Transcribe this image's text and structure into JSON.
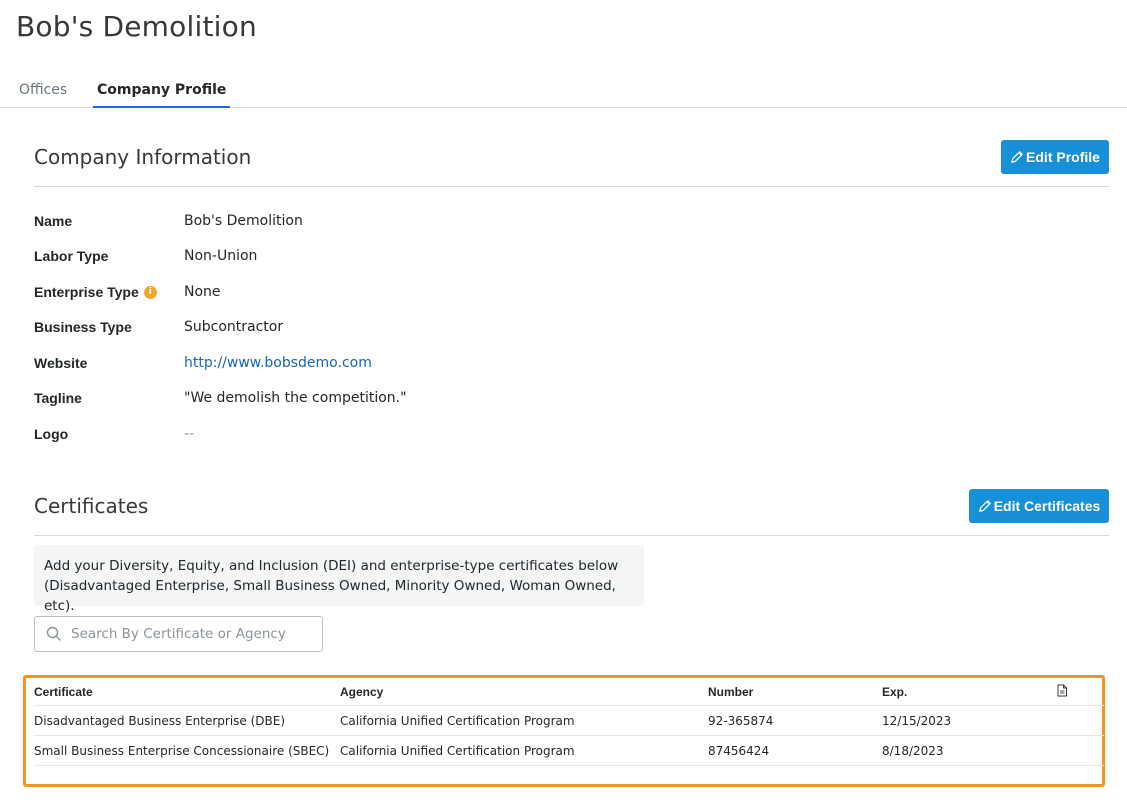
{
  "page": {
    "title": "Bob's Demolition"
  },
  "tabs": [
    {
      "label": "Offices",
      "active": false
    },
    {
      "label": "Company Profile",
      "active": true
    }
  ],
  "company_info": {
    "title": "Company Information",
    "edit_button": "Edit Profile",
    "fields": {
      "name": {
        "label": "Name",
        "value": "Bob's Demolition"
      },
      "labor_type": {
        "label": "Labor Type",
        "value": "Non-Union"
      },
      "enterprise_type": {
        "label": "Enterprise Type",
        "value": "None",
        "info_icon": "i"
      },
      "business_type": {
        "label": "Business Type",
        "value": "Subcontractor"
      },
      "website": {
        "label": "Website",
        "value": "http://www.bobsdemo.com"
      },
      "tagline": {
        "label": "Tagline",
        "value": "\"We demolish the competition.\""
      },
      "logo": {
        "label": "Logo",
        "value": "--"
      }
    }
  },
  "certificates": {
    "title": "Certificates",
    "edit_button": "Edit Certificates",
    "note_line1": "Add your Diversity, Equity, and Inclusion (DEI) and enterprise-type certificates below",
    "note_line2": "(Disadvantaged Enterprise, Small Business Owned, Minority Owned, Woman Owned, etc).",
    "search_placeholder": "Search By Certificate or Agency",
    "columns": {
      "certificate": "Certificate",
      "agency": "Agency",
      "number": "Number",
      "exp": "Exp."
    },
    "rows": [
      {
        "certificate": "Disadvantaged Business Enterprise (DBE)",
        "agency": "California Unified Certification Program",
        "number": "92-365874",
        "exp": "12/15/2023"
      },
      {
        "certificate": "Small Business Enterprise Concessionaire (SBEC)",
        "agency": "California Unified Certification Program",
        "number": "87456424",
        "exp": "8/18/2023"
      }
    ]
  },
  "colors": {
    "primary_button": "#1890d8",
    "highlight_frame": "#f7941d",
    "link": "#1565b8",
    "info_badge": "#f5a623"
  },
  "icons": {
    "edit": "pencil-icon",
    "search": "search-icon",
    "export": "document-icon",
    "info": "info-icon"
  }
}
